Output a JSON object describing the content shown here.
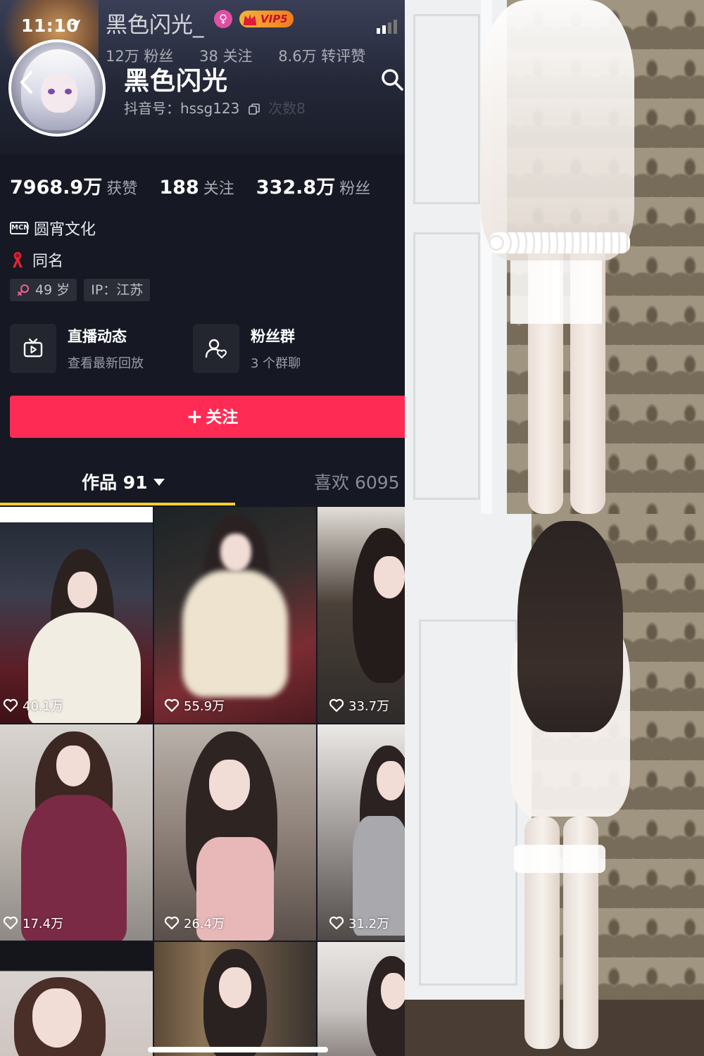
{
  "status_bar": {
    "time": "11:10"
  },
  "header": {
    "ghost_name": "黑色闪光_",
    "vip_label": "VIP5",
    "ghost_stats": [
      "12万 粉丝",
      "38 关注",
      "8.6万 转评赞"
    ],
    "profile_name": "黑色闪光",
    "douyin_id": "抖音号：hssg123",
    "ghost_visits": "次数8"
  },
  "stats": [
    {
      "value": "7968.9万",
      "label": "获赞"
    },
    {
      "value": "188",
      "label": "关注"
    },
    {
      "value": "332.8万",
      "label": "粉丝"
    }
  ],
  "info": {
    "mcn_badge": "MCN",
    "mcn": "圆宵文化",
    "tagline": "同名"
  },
  "tags": {
    "age": "49 岁",
    "ip": "IP：江苏"
  },
  "cards": [
    {
      "title": "直播动态",
      "subtitle": "查看最新回放",
      "icon": "live-tv-icon"
    },
    {
      "title": "粉丝群",
      "subtitle": "3 个群聊",
      "icon": "fan-group-icon"
    }
  ],
  "follow_button": {
    "plus": "+",
    "label": "关注"
  },
  "tabs": {
    "works": "作品 91",
    "likes": "喜欢 6095"
  },
  "videos": [
    {
      "likes": "40.1万"
    },
    {
      "likes": "55.9万"
    },
    {
      "likes": "33.7万"
    },
    {
      "likes": "17.4万"
    },
    {
      "likes": "26.4万"
    },
    {
      "likes": "31.2万"
    }
  ],
  "colors": {
    "accent": "#fe2c55",
    "tab_indicator": "#fcce2d",
    "background": "#161823"
  }
}
